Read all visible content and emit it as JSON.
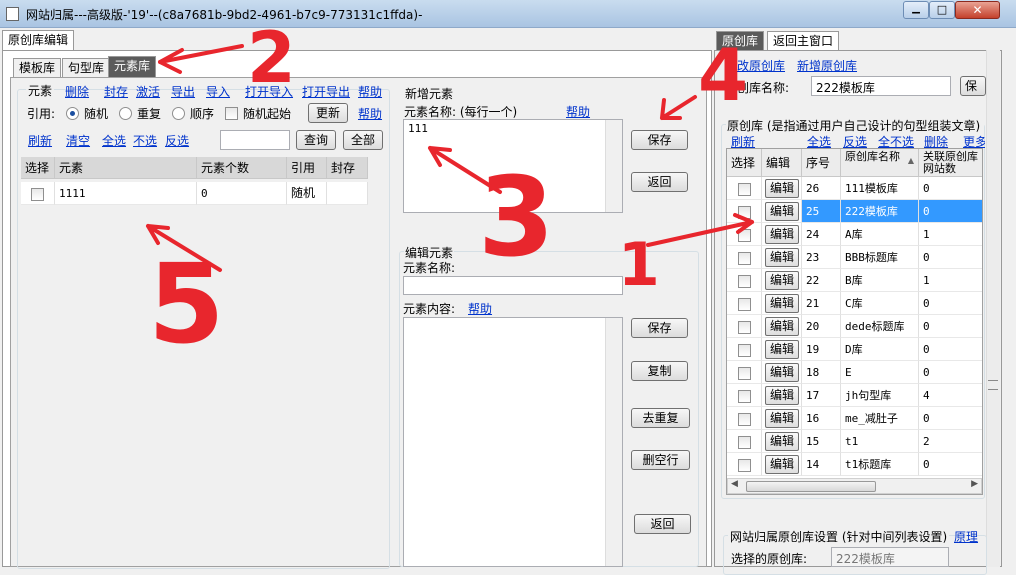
{
  "window": {
    "title": "网站归属---高级版-'19'--(c8a7681b-9bd2-4961-b7c9-773131c1ffda)-",
    "min": "▁",
    "max": "□",
    "close": "✕"
  },
  "left_tabs": {
    "outer": "原创库编辑",
    "inner": [
      "模板库",
      "句型库",
      "元素库"
    ]
  },
  "element_group": {
    "title": "元素",
    "links": [
      "删除",
      "封存",
      "激活",
      "导出",
      "导入",
      "打开导入",
      "打开导出",
      "帮助"
    ],
    "ref_label": "引用:",
    "radios": [
      "随机",
      "重复",
      "顺序"
    ],
    "random_start": "随机起始",
    "update_btn": "更新",
    "help2": "帮助",
    "links2": [
      "刷新",
      "清空",
      "全选",
      "不选",
      "反选"
    ],
    "search_value": "",
    "query_btn": "查询",
    "all_btn": "全部"
  },
  "element_table": {
    "headers": [
      "选择",
      "元素",
      "元素个数",
      "引用",
      "封存"
    ],
    "rows": [
      {
        "element": "1111",
        "count": "0",
        "ref": "随机",
        "sealed": ""
      }
    ]
  },
  "new_element": {
    "title": "新增元素",
    "name_label": "元素名称: (每行一个)",
    "help": "帮助",
    "value": "111",
    "save": "保存",
    "back": "返回"
  },
  "edit_element": {
    "title": "编辑元素",
    "name_label": "元素名称:",
    "name_value": "",
    "content_label": "元素内容:",
    "help": "帮助",
    "buttons": [
      "保存",
      "复制",
      "去重复",
      "删空行",
      "返回"
    ]
  },
  "right_tabs": [
    "原创库",
    "返回主窗口"
  ],
  "right_panel": {
    "link1": "修改原创库",
    "link2": "新增原创库",
    "name_label": "原创库名称:",
    "name_value": "222模板库",
    "save_btn": "保",
    "group_title": "原创库 (是指通过用户自己设计的句型组装文章)",
    "links": [
      "刷新",
      "全选",
      "反选",
      "全不选",
      "删除",
      "更多"
    ],
    "headers": [
      "选择",
      "编辑",
      "序号",
      "原创库名称",
      "关联原创库网站数"
    ],
    "edit_label": "编辑",
    "rows": [
      {
        "id": "26",
        "name": "111模板库",
        "sites": "0"
      },
      {
        "id": "25",
        "name": "222模板库",
        "sites": "0"
      },
      {
        "id": "24",
        "name": "A库",
        "sites": "1"
      },
      {
        "id": "23",
        "name": "BBB标题库",
        "sites": "0"
      },
      {
        "id": "22",
        "name": "B库",
        "sites": "1"
      },
      {
        "id": "21",
        "name": "C库",
        "sites": "0"
      },
      {
        "id": "20",
        "name": "dede标题库",
        "sites": "0"
      },
      {
        "id": "19",
        "name": "D库",
        "sites": "0"
      },
      {
        "id": "18",
        "name": "E",
        "sites": "0"
      },
      {
        "id": "17",
        "name": "jh句型库",
        "sites": "4"
      },
      {
        "id": "16",
        "name": "me_减肚子",
        "sites": "0"
      },
      {
        "id": "15",
        "name": "t1",
        "sites": "2"
      },
      {
        "id": "14",
        "name": "t1标题库",
        "sites": "0"
      }
    ],
    "settings_title": "网站归属原创库设置 (针对中间列表设置)",
    "settings_link": "原理",
    "selected_label": "选择的原创库:",
    "selected_value": "222模板库"
  },
  "annotations": {
    "n1": "1",
    "n2": "2",
    "n3": "3",
    "n4": "4",
    "n5": "5",
    "color": "#e8262d"
  }
}
